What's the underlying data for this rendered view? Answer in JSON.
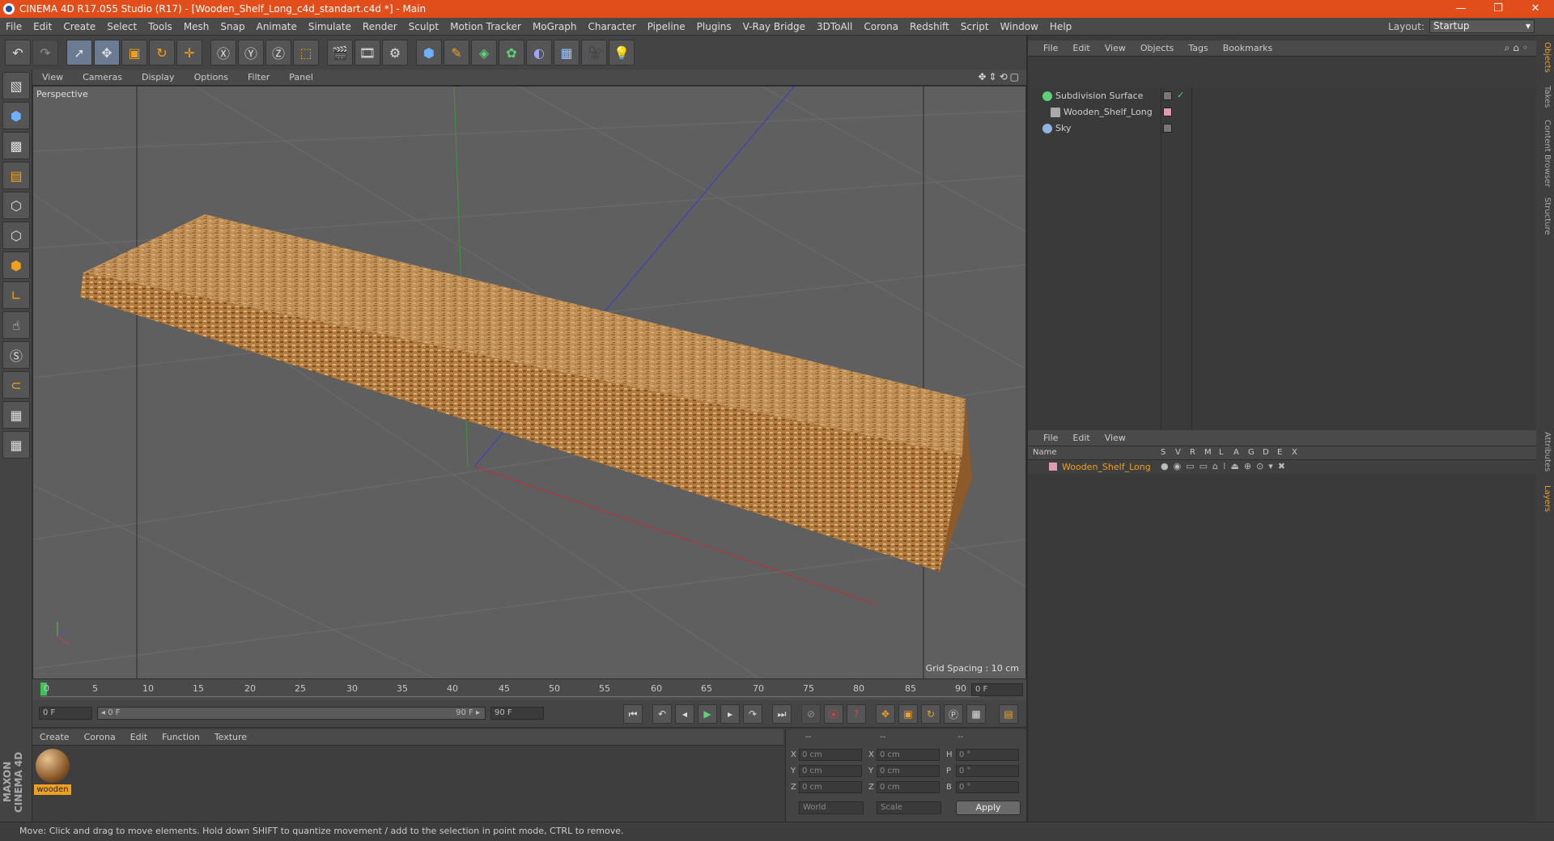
{
  "title": "CINEMA 4D R17.055 Studio (R17) - [Wooden_Shelf_Long_c4d_standart.c4d *] - Main",
  "window_controls": [
    "—",
    "❐",
    "✕"
  ],
  "menu": [
    "File",
    "Edit",
    "Create",
    "Select",
    "Tools",
    "Mesh",
    "Snap",
    "Animate",
    "Simulate",
    "Render",
    "Sculpt",
    "Motion Tracker",
    "MoGraph",
    "Character",
    "Pipeline",
    "Plugins",
    "V-Ray Bridge",
    "3DToAll",
    "Corona",
    "Redshift",
    "Script",
    "Window",
    "Help"
  ],
  "layout": {
    "label": "Layout:",
    "value": "Startup"
  },
  "viewport": {
    "menu": [
      "View",
      "Cameras",
      "Display",
      "Options",
      "Filter",
      "Panel"
    ],
    "camera": "Perspective",
    "grid_spacing": "Grid Spacing : 10 cm"
  },
  "timeline": {
    "ticks": [
      "0",
      "5",
      "10",
      "15",
      "20",
      "25",
      "30",
      "35",
      "40",
      "45",
      "50",
      "55",
      "60",
      "65",
      "70",
      "75",
      "80",
      "85",
      "90"
    ],
    "current_frame": "0 F",
    "start": "0 F",
    "range_start": "◂ 0 F",
    "range_end": "90 F ▸",
    "end": "90 F"
  },
  "material_manager": {
    "menu": [
      "Create",
      "Corona",
      "Edit",
      "Function",
      "Texture"
    ],
    "material_name": "wooden"
  },
  "coords": {
    "headers": [
      "--",
      "--",
      "--"
    ],
    "rows": [
      {
        "a": "X",
        "av": "0 cm",
        "b": "X",
        "bv": "0 cm",
        "c": "H",
        "cv": "0 °"
      },
      {
        "a": "Y",
        "av": "0 cm",
        "b": "Y",
        "bv": "0 cm",
        "c": "P",
        "cv": "0 °"
      },
      {
        "a": "Z",
        "av": "0 cm",
        "b": "Z",
        "bv": "0 cm",
        "c": "B",
        "cv": "0 °"
      }
    ],
    "mode1": "World",
    "mode2": "Scale",
    "apply": "Apply"
  },
  "objects": {
    "menu": [
      "File",
      "Edit",
      "View",
      "Objects",
      "Tags",
      "Bookmarks"
    ],
    "items": [
      "Subdivision Surface",
      "Wooden_Shelf_Long",
      "Sky"
    ]
  },
  "layers": {
    "menu": [
      "File",
      "Edit",
      "View"
    ],
    "columns": [
      "Name",
      "S",
      "V",
      "R",
      "M",
      "L",
      "A",
      "G",
      "D",
      "E",
      "X"
    ],
    "row": "Wooden_Shelf_Long"
  },
  "side_tabs": [
    "Objects",
    "Takes",
    "Content Browser",
    "Structure",
    "Attributes",
    "Layers"
  ],
  "status": "Move: Click and drag to move elements. Hold down SHIFT to quantize movement / add to the selection in point mode, CTRL to remove.",
  "brand": "MAXON CINEMA 4D",
  "colors": {
    "title_bar": "#e24e1b",
    "accent": "#f0a020",
    "wood": "#b88449"
  }
}
